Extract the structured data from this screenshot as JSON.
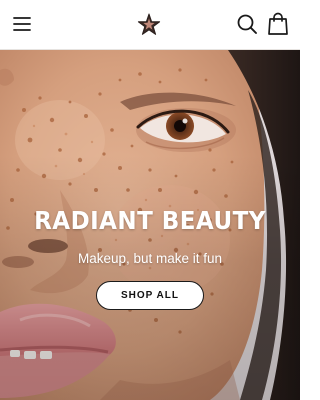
{
  "header": {
    "menu_icon": "hamburger-menu-icon",
    "logo_icon": "star-logo-icon",
    "search_icon": "search-icon",
    "bag_icon": "shopping-bag-icon",
    "logo_colors": {
      "fill": "#3a2a26",
      "accent": "#d99a8a"
    }
  },
  "hero": {
    "title": "RADIANT BEAUTY",
    "subtitle": "Makeup, but make it fun",
    "cta_label": "SHOP ALL",
    "image_icon": "freckled-face-photo",
    "colors": {
      "skin": "#d9a583",
      "freckle": "#a8623a",
      "lip": "#d27d7d",
      "hair": "#2a1f1c"
    }
  }
}
